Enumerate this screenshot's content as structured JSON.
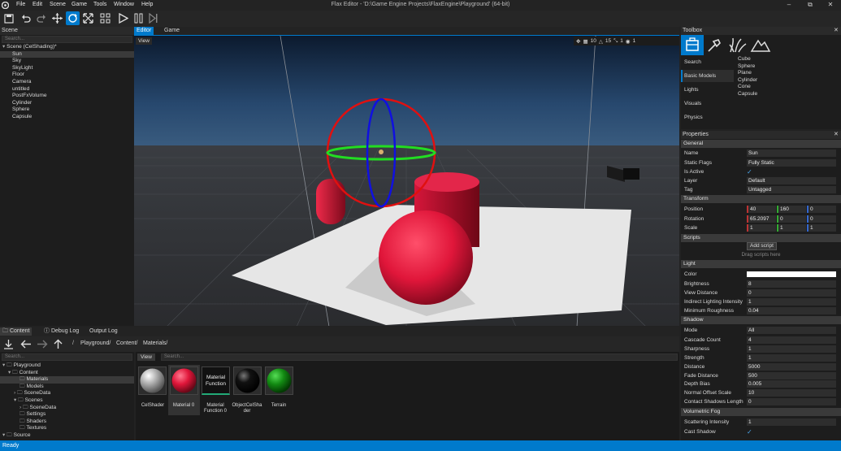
{
  "title_bar": {
    "menus": [
      "File",
      "Edit",
      "Scene",
      "Game",
      "Tools",
      "Window",
      "Help"
    ],
    "title": "Flax Editor - 'D:\\Game Engine Projects\\FlaxEngine\\Playground' (64-bit)"
  },
  "scene_panel": {
    "header": "Scene",
    "search_placeholder": "Search...",
    "root": "Scene (CelShading)*",
    "items": [
      "Sun",
      "Sky",
      "SkyLight",
      "Floor",
      "Camera",
      "untitled",
      "PostFxVolume",
      "Cylinder",
      "Sphere",
      "Capsule"
    ]
  },
  "viewport": {
    "tabs": [
      "Editor",
      "Game"
    ],
    "view_button": "View",
    "stats": {
      "grid": "10",
      "angle": "15",
      "scale": "1",
      "speed": "1"
    }
  },
  "toolbox": {
    "header": "Toolbox",
    "categories": [
      "Search",
      "Basic Models",
      "Lights",
      "Visuals",
      "Physics"
    ],
    "items": [
      "Cube",
      "Sphere",
      "Plane",
      "Cylinder",
      "Cone",
      "Capsule"
    ]
  },
  "properties": {
    "header": "Properties",
    "general": {
      "label": "General",
      "name_label": "Name",
      "name": "Sun",
      "static_label": "Static Flags",
      "static": "Fully Static",
      "active_label": "Is Active",
      "layer_label": "Layer",
      "layer": "Default",
      "tag_label": "Tag",
      "tag": "Untagged"
    },
    "transform": {
      "label": "Transform",
      "position_label": "Position",
      "position": [
        "40",
        "160",
        "0"
      ],
      "rotation_label": "Rotation",
      "rotation": [
        "65.2097",
        "0",
        "0"
      ],
      "scale_label": "Scale",
      "scale": [
        "1",
        "1",
        "1"
      ]
    },
    "scripts": {
      "label": "Scripts",
      "add": "Add script",
      "hint": "Drag scripts here"
    },
    "light": {
      "label": "Light",
      "color_label": "Color",
      "brightness_label": "Brightness",
      "brightness": "8",
      "view_distance_label": "View Distance",
      "view_distance": "0",
      "indirect_label": "Indirect Lighting Intensity",
      "indirect": "1",
      "min_rough_label": "Minimum Roughness",
      "min_rough": "0.04"
    },
    "shadow": {
      "label": "Shadow",
      "mode_label": "Mode",
      "mode": "All",
      "cascade_label": "Cascade Count",
      "cascade": "4",
      "sharp_label": "Sharpness",
      "sharp": "1",
      "strength_label": "Strength",
      "strength": "1",
      "distance_label": "Distance",
      "distance": "5000",
      "fade_label": "Fade Distance",
      "fade": "500",
      "bias_label": "Depth Bias",
      "bias": "0.005",
      "normal_label": "Normal Offset Scale",
      "normal": "10",
      "contact_label": "Contact Shadows Length",
      "contact": "0"
    },
    "fog": {
      "label": "Volumetric Fog",
      "scatter_label": "Scattering Intensity",
      "scatter": "1",
      "cast_label": "Cast Shadow"
    }
  },
  "content": {
    "tabs": [
      "Content",
      "Debug Log",
      "Output Log"
    ],
    "breadcrumb": [
      "Playground/",
      "Content/",
      "Materials/"
    ],
    "search_placeholder": "Search...",
    "view_button": "View",
    "asset_search_placeholder": "Search...",
    "tree": [
      "Playground",
      "Content",
      "Materials",
      "Models",
      "SceneData",
      "Scenes",
      "SceneData",
      "Settings",
      "Shaders",
      "Textures",
      "Source"
    ],
    "assets": [
      "CelShader",
      "Material 0",
      "Material\nFunction 0",
      "ObjectCelSha\nder",
      "Terrain"
    ],
    "function_thumb": "Material\nFunction"
  },
  "status": "Ready"
}
